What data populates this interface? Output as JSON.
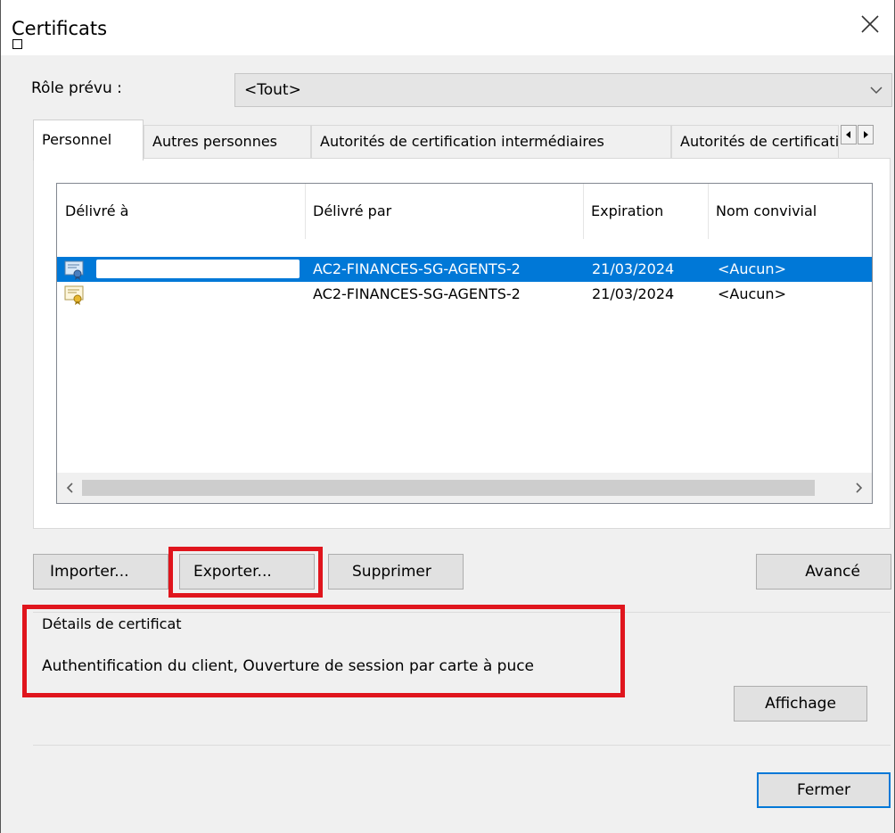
{
  "window": {
    "title": "Certificats",
    "close_icon": "close-icon"
  },
  "role": {
    "label": "Rôle prévu :",
    "selected_value": "<Tout>"
  },
  "tabs": [
    {
      "label": "Personnel",
      "active": true
    },
    {
      "label": "Autres personnes",
      "active": false
    },
    {
      "label": "Autorités de certification intermédiaires",
      "active": false
    },
    {
      "label": "Autorités de certification racines de confiance",
      "active": false
    }
  ],
  "certificates": {
    "columns": [
      "Délivré à",
      "Délivré par",
      "Expiration",
      "Nom convivial"
    ],
    "rows": [
      {
        "issued_to": "",
        "issued_by": "AC2-FINANCES-SG-AGENTS-2",
        "expiration": "21/03/2024",
        "friendly_name": "<Aucun>",
        "selected": true,
        "icon": "certificate-icon"
      },
      {
        "issued_to": "",
        "issued_by": "AC2-FINANCES-SG-AGENTS-2",
        "expiration": "21/03/2024",
        "friendly_name": "<Aucun>",
        "selected": false,
        "icon": "certificate-icon"
      }
    ]
  },
  "buttons": {
    "import": "Importer...",
    "export": "Exporter...",
    "delete": "Supprimer",
    "advanced": "Avancé",
    "view": "Affichage",
    "close": "Fermer"
  },
  "details": {
    "title": "Détails de certificat",
    "purposes": "Authentification du client, Ouverture de session par carte à puce"
  },
  "colors": {
    "selection": "#0078d7",
    "annotation_red": "#e0151d",
    "button_face": "#e1e1e1",
    "dialog_bg": "#f0f0f0"
  }
}
